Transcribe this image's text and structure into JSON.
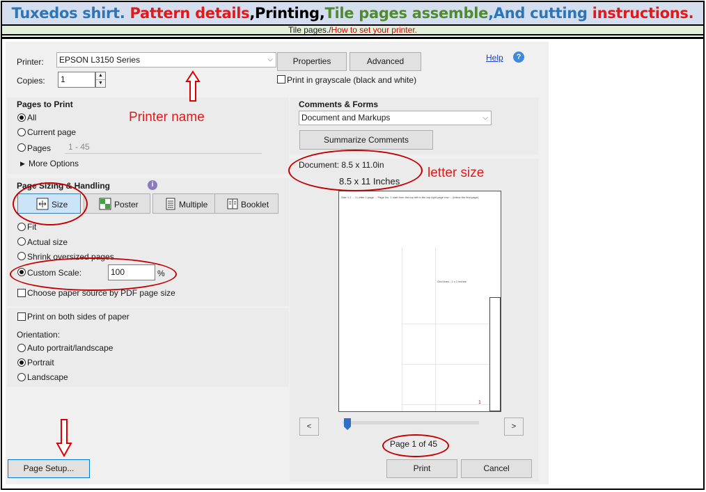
{
  "banner": {
    "part1": "Tuxedos shirt. ",
    "part2": "Pattern details",
    "part3": ",Printing,",
    "part4": "Tile pages assemble",
    "part5": ",And cutting ",
    "part6": "instructions."
  },
  "subbar": {
    "text1": "Tile pages./",
    "text2": "How to set your printer."
  },
  "printer": {
    "label": "Printer:",
    "name": "EPSON L3150 Series",
    "properties_label": "Properties",
    "advanced_label": "Advanced",
    "help_label": "Help",
    "copies_label": "Copies:",
    "copies_value": "1",
    "grayscale_label": "Print in grayscale (black and white)"
  },
  "pages_to_print": {
    "heading": "Pages to Print",
    "all_label": "All",
    "current_label": "Current page",
    "pages_label": "Pages",
    "pages_value": "1 - 45",
    "more_options_label": "More Options"
  },
  "sizing": {
    "heading": "Page Sizing & Handling",
    "size_label": "Size",
    "poster_label": "Poster",
    "multiple_label": "Multiple",
    "booklet_label": "Booklet",
    "fit_label": "Fit",
    "actual_label": "Actual size",
    "shrink_label": "Shrink oversized pages",
    "custom_label": "Custom Scale:",
    "custom_value": "100",
    "percent": "%",
    "choose_source_label": "Choose paper source by PDF page size"
  },
  "duplex": {
    "both_sides_label": "Print on both sides of paper",
    "orientation_label": "Orientation:",
    "auto_label": "Auto portrait/landscape",
    "portrait_label": "Portrait",
    "landscape_label": "Landscape"
  },
  "comments": {
    "heading": "Comments & Forms",
    "selected": "Document and Markups",
    "summarize_label": "Summarize Comments"
  },
  "preview": {
    "document_size": "Document: 8.5 x 11.0in",
    "page_label": "Page 1 of 45",
    "page_text": "Size 1:1 ... 1 Letter 1 page ... Page No. 1 start from the top left to the top right page row ... (follow the first page)",
    "grid_text": "Grid lines - 1 x 1 inches",
    "page_number": "1"
  },
  "footer": {
    "page_setup_label": "Page Setup...",
    "print_label": "Print",
    "cancel_label": "Cancel"
  },
  "annotations": {
    "printer_name": "Printer name",
    "letter_size": "letter size",
    "letter_inches": "8.5 x 11 Inches"
  },
  "colors": {
    "annotation_red": "#e01a1a",
    "banner_bg": "#d5deef",
    "subbar_bg": "#e2efd9",
    "help_blue": "#3a8be0"
  }
}
